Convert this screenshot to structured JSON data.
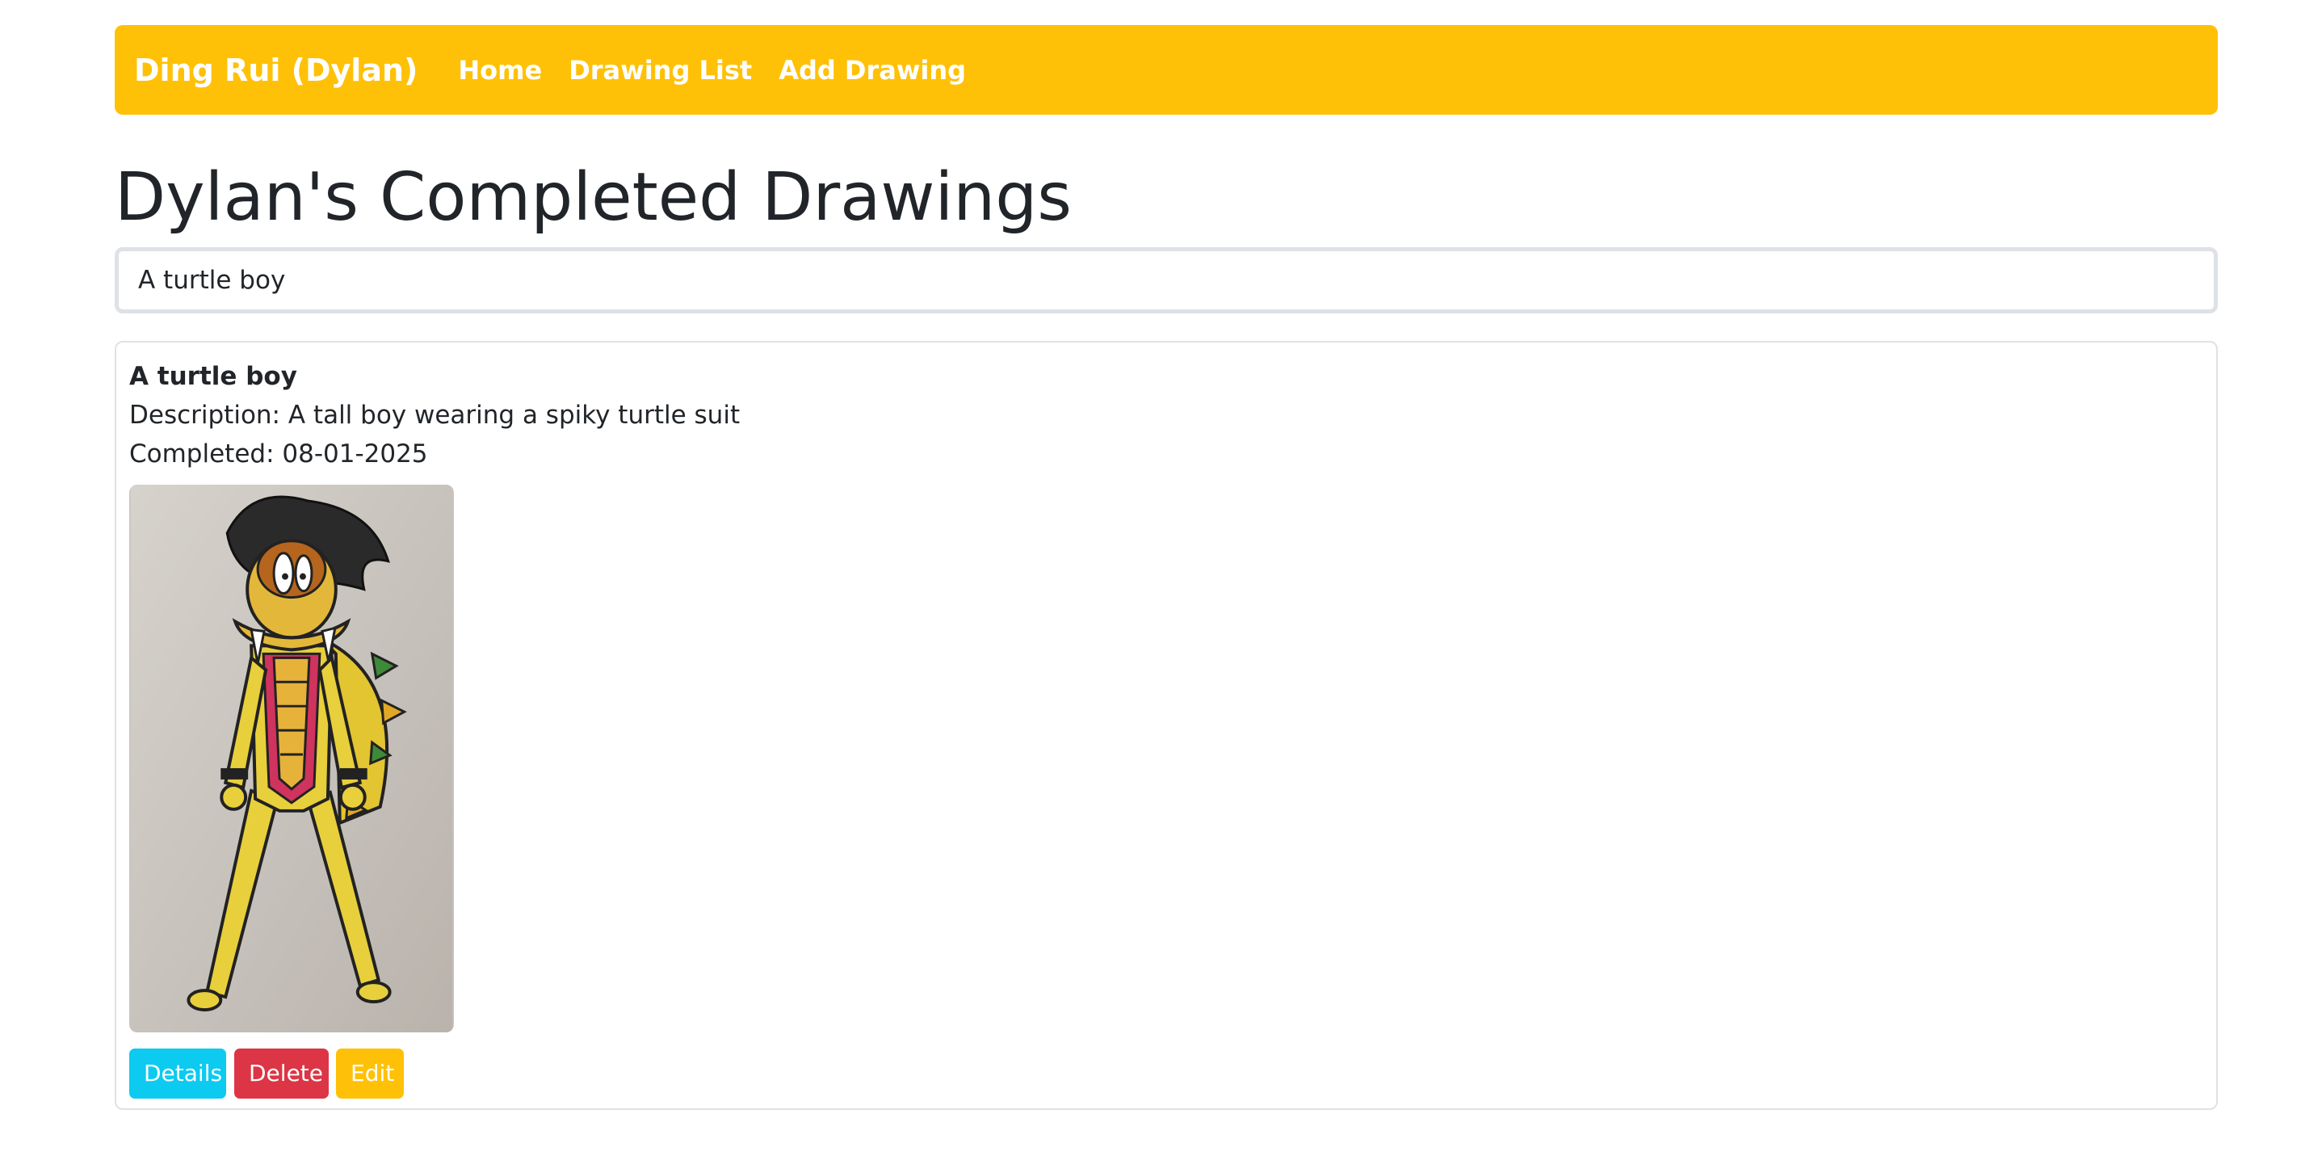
{
  "navbar": {
    "brand": "Ding Rui (Dylan)",
    "links": [
      {
        "label": "Home"
      },
      {
        "label": "Drawing List"
      },
      {
        "label": "Add Drawing"
      }
    ],
    "color": "#ffc107"
  },
  "main": {
    "title": "Dylan's Completed Drawings"
  },
  "search": {
    "value": "A turtle boy"
  },
  "results": [
    {
      "title": "A turtle boy",
      "description": "Description: A tall boy wearing a spiky turtle suit",
      "completed": "Completed: 08-01-2025",
      "image_subject": "pencil drawing of a boy in a yellow turtle costume with a spiked shell",
      "buttons": {
        "details": "Details",
        "delete": "Delete",
        "edit": "Edit"
      }
    }
  ],
  "colors": {
    "accent": "#ffc107",
    "details": "#0dcaf0",
    "delete": "#dc3545",
    "edit": "#ffc107"
  }
}
